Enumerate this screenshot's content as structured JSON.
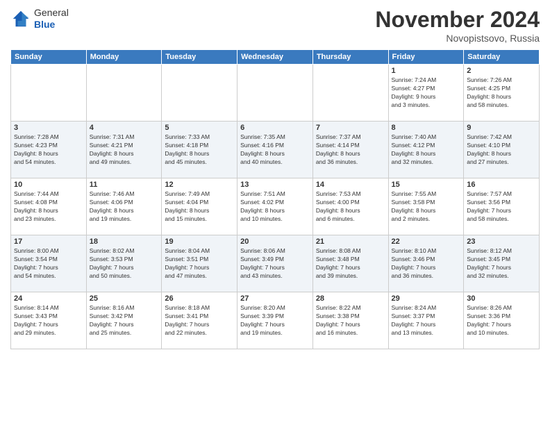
{
  "logo": {
    "line1": "General",
    "line2": "Blue"
  },
  "title": "November 2024",
  "location": "Novopistsovo, Russia",
  "weekdays": [
    "Sunday",
    "Monday",
    "Tuesday",
    "Wednesday",
    "Thursday",
    "Friday",
    "Saturday"
  ],
  "weeks": [
    [
      {
        "day": "",
        "info": ""
      },
      {
        "day": "",
        "info": ""
      },
      {
        "day": "",
        "info": ""
      },
      {
        "day": "",
        "info": ""
      },
      {
        "day": "",
        "info": ""
      },
      {
        "day": "1",
        "info": "Sunrise: 7:24 AM\nSunset: 4:27 PM\nDaylight: 9 hours\nand 3 minutes."
      },
      {
        "day": "2",
        "info": "Sunrise: 7:26 AM\nSunset: 4:25 PM\nDaylight: 8 hours\nand 58 minutes."
      }
    ],
    [
      {
        "day": "3",
        "info": "Sunrise: 7:28 AM\nSunset: 4:23 PM\nDaylight: 8 hours\nand 54 minutes."
      },
      {
        "day": "4",
        "info": "Sunrise: 7:31 AM\nSunset: 4:21 PM\nDaylight: 8 hours\nand 49 minutes."
      },
      {
        "day": "5",
        "info": "Sunrise: 7:33 AM\nSunset: 4:18 PM\nDaylight: 8 hours\nand 45 minutes."
      },
      {
        "day": "6",
        "info": "Sunrise: 7:35 AM\nSunset: 4:16 PM\nDaylight: 8 hours\nand 40 minutes."
      },
      {
        "day": "7",
        "info": "Sunrise: 7:37 AM\nSunset: 4:14 PM\nDaylight: 8 hours\nand 36 minutes."
      },
      {
        "day": "8",
        "info": "Sunrise: 7:40 AM\nSunset: 4:12 PM\nDaylight: 8 hours\nand 32 minutes."
      },
      {
        "day": "9",
        "info": "Sunrise: 7:42 AM\nSunset: 4:10 PM\nDaylight: 8 hours\nand 27 minutes."
      }
    ],
    [
      {
        "day": "10",
        "info": "Sunrise: 7:44 AM\nSunset: 4:08 PM\nDaylight: 8 hours\nand 23 minutes."
      },
      {
        "day": "11",
        "info": "Sunrise: 7:46 AM\nSunset: 4:06 PM\nDaylight: 8 hours\nand 19 minutes."
      },
      {
        "day": "12",
        "info": "Sunrise: 7:49 AM\nSunset: 4:04 PM\nDaylight: 8 hours\nand 15 minutes."
      },
      {
        "day": "13",
        "info": "Sunrise: 7:51 AM\nSunset: 4:02 PM\nDaylight: 8 hours\nand 10 minutes."
      },
      {
        "day": "14",
        "info": "Sunrise: 7:53 AM\nSunset: 4:00 PM\nDaylight: 8 hours\nand 6 minutes."
      },
      {
        "day": "15",
        "info": "Sunrise: 7:55 AM\nSunset: 3:58 PM\nDaylight: 8 hours\nand 2 minutes."
      },
      {
        "day": "16",
        "info": "Sunrise: 7:57 AM\nSunset: 3:56 PM\nDaylight: 7 hours\nand 58 minutes."
      }
    ],
    [
      {
        "day": "17",
        "info": "Sunrise: 8:00 AM\nSunset: 3:54 PM\nDaylight: 7 hours\nand 54 minutes."
      },
      {
        "day": "18",
        "info": "Sunrise: 8:02 AM\nSunset: 3:53 PM\nDaylight: 7 hours\nand 50 minutes."
      },
      {
        "day": "19",
        "info": "Sunrise: 8:04 AM\nSunset: 3:51 PM\nDaylight: 7 hours\nand 47 minutes."
      },
      {
        "day": "20",
        "info": "Sunrise: 8:06 AM\nSunset: 3:49 PM\nDaylight: 7 hours\nand 43 minutes."
      },
      {
        "day": "21",
        "info": "Sunrise: 8:08 AM\nSunset: 3:48 PM\nDaylight: 7 hours\nand 39 minutes."
      },
      {
        "day": "22",
        "info": "Sunrise: 8:10 AM\nSunset: 3:46 PM\nDaylight: 7 hours\nand 36 minutes."
      },
      {
        "day": "23",
        "info": "Sunrise: 8:12 AM\nSunset: 3:45 PM\nDaylight: 7 hours\nand 32 minutes."
      }
    ],
    [
      {
        "day": "24",
        "info": "Sunrise: 8:14 AM\nSunset: 3:43 PM\nDaylight: 7 hours\nand 29 minutes."
      },
      {
        "day": "25",
        "info": "Sunrise: 8:16 AM\nSunset: 3:42 PM\nDaylight: 7 hours\nand 25 minutes."
      },
      {
        "day": "26",
        "info": "Sunrise: 8:18 AM\nSunset: 3:41 PM\nDaylight: 7 hours\nand 22 minutes."
      },
      {
        "day": "27",
        "info": "Sunrise: 8:20 AM\nSunset: 3:39 PM\nDaylight: 7 hours\nand 19 minutes."
      },
      {
        "day": "28",
        "info": "Sunrise: 8:22 AM\nSunset: 3:38 PM\nDaylight: 7 hours\nand 16 minutes."
      },
      {
        "day": "29",
        "info": "Sunrise: 8:24 AM\nSunset: 3:37 PM\nDaylight: 7 hours\nand 13 minutes."
      },
      {
        "day": "30",
        "info": "Sunrise: 8:26 AM\nSunset: 3:36 PM\nDaylight: 7 hours\nand 10 minutes."
      }
    ]
  ]
}
